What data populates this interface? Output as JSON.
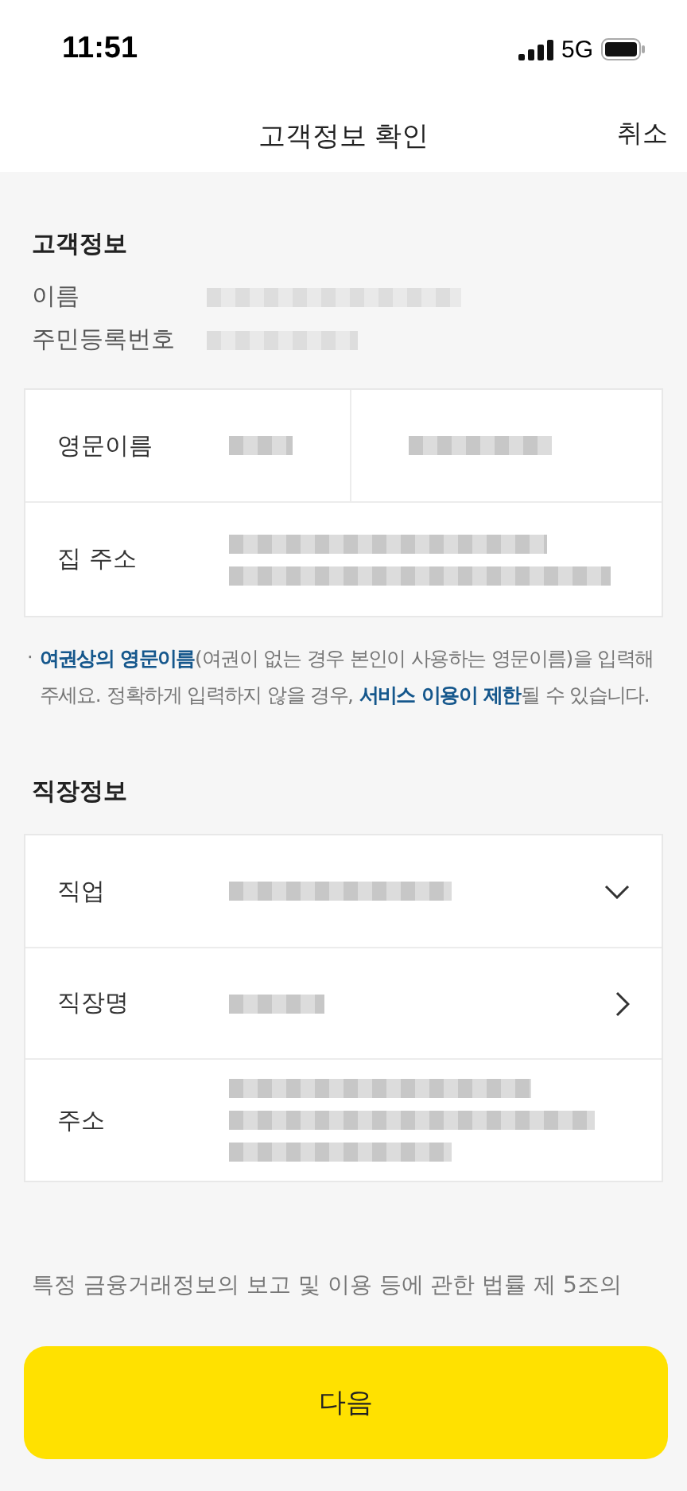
{
  "status_bar": {
    "time": "11:51",
    "network": "5G"
  },
  "header": {
    "title": "고객정보 확인",
    "cancel": "취소"
  },
  "customer": {
    "title": "고객정보",
    "fields": [
      {
        "label": "이름"
      },
      {
        "label": "주민등록번호"
      }
    ]
  },
  "card": [
    {
      "label": "영문이름",
      "kind": "split"
    },
    {
      "label": "집 주소",
      "kind": "address"
    }
  ],
  "note_bullet": "·",
  "note": "**여권상의 영문이름**(여권이 없는 경우 본인이 사용하는 영문이름)을 입력해주세요. 정확하게 입력하지 않을 경우, **서비스 이용이 제한**될 수 있습니다.",
  "work": {
    "title": "직장정보",
    "rows": [
      {
        "label": "직업",
        "kind": "dropdown"
      },
      {
        "label": "직장명",
        "kind": "navigate"
      },
      {
        "label": "주소",
        "kind": "address"
      }
    ]
  },
  "legal_text": "특정 금융거래정보의 보고 및 이용 등에 관한 법률 제 5조의",
  "next_button": "다음"
}
